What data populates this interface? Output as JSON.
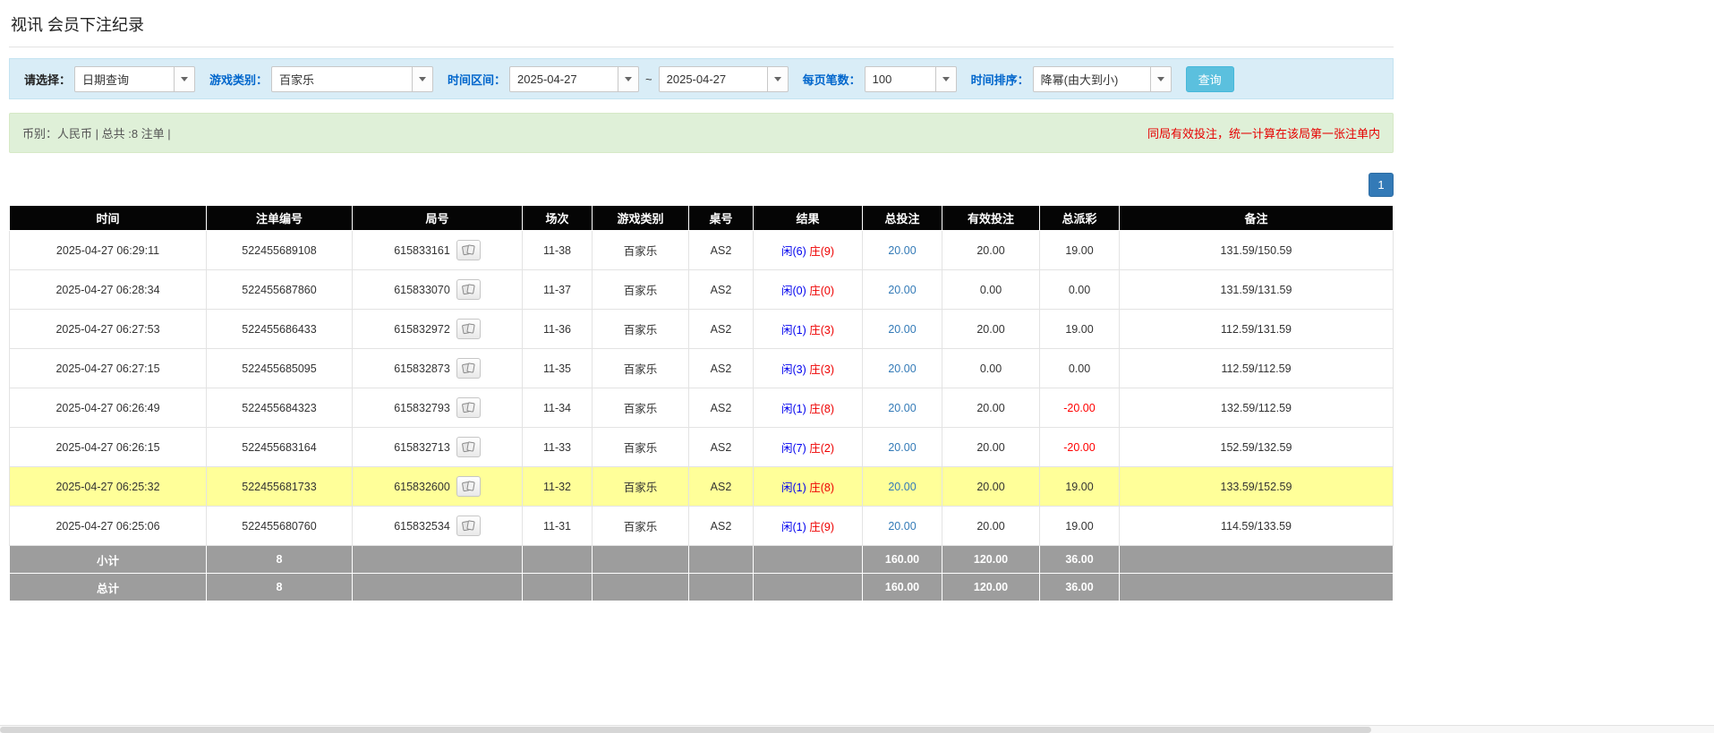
{
  "page": {
    "title": "视讯 会员下注纪录"
  },
  "filters": {
    "select_label": "请选择：",
    "select_value": "日期查询",
    "game_type_label": "游戏类别：",
    "game_type_value": "百家乐",
    "time_range_label": "时间区间：",
    "date_from": "2025-04-27",
    "range_separator": "~",
    "date_to": "2025-04-27",
    "page_size_label": "每页笔数：",
    "page_size_value": "100",
    "sort_label": "时间排序：",
    "sort_value": "降幂(由大到小)",
    "search_button_label": "查询"
  },
  "summary": {
    "left_text": "币别：人民币 | 总共 :8 注单 |",
    "right_note": "同局有效投注，统一计算在该局第一张注单内"
  },
  "pagination": {
    "current_page": "1"
  },
  "table": {
    "headers": [
      "时间",
      "注单编号",
      "局号",
      "场次",
      "游戏类别",
      "桌号",
      "结果",
      "总投注",
      "有效投注",
      "总派彩",
      "备注"
    ],
    "rows": [
      {
        "time": "2025-04-27 06:29:11",
        "bet_id": "522455689108",
        "round_id": "615833161",
        "session": "11-38",
        "game_type": "百家乐",
        "table_no": "AS2",
        "result_player": "闲(6)",
        "result_banker": "庄(9)",
        "total_bet": "20.00",
        "valid_bet": "20.00",
        "payout": "19.00",
        "remark": "131.59/150.59",
        "highlight": false
      },
      {
        "time": "2025-04-27 06:28:34",
        "bet_id": "522455687860",
        "round_id": "615833070",
        "session": "11-37",
        "game_type": "百家乐",
        "table_no": "AS2",
        "result_player": "闲(0)",
        "result_banker": "庄(0)",
        "total_bet": "20.00",
        "valid_bet": "0.00",
        "payout": "0.00",
        "remark": "131.59/131.59",
        "highlight": false
      },
      {
        "time": "2025-04-27 06:27:53",
        "bet_id": "522455686433",
        "round_id": "615832972",
        "session": "11-36",
        "game_type": "百家乐",
        "table_no": "AS2",
        "result_player": "闲(1)",
        "result_banker": "庄(3)",
        "total_bet": "20.00",
        "valid_bet": "20.00",
        "payout": "19.00",
        "remark": "112.59/131.59",
        "highlight": false
      },
      {
        "time": "2025-04-27 06:27:15",
        "bet_id": "522455685095",
        "round_id": "615832873",
        "session": "11-35",
        "game_type": "百家乐",
        "table_no": "AS2",
        "result_player": "闲(3)",
        "result_banker": "庄(3)",
        "total_bet": "20.00",
        "valid_bet": "0.00",
        "payout": "0.00",
        "remark": "112.59/112.59",
        "highlight": false
      },
      {
        "time": "2025-04-27 06:26:49",
        "bet_id": "522455684323",
        "round_id": "615832793",
        "session": "11-34",
        "game_type": "百家乐",
        "table_no": "AS2",
        "result_player": "闲(1)",
        "result_banker": "庄(8)",
        "total_bet": "20.00",
        "valid_bet": "20.00",
        "payout": "-20.00",
        "remark": "132.59/112.59",
        "highlight": false
      },
      {
        "time": "2025-04-27 06:26:15",
        "bet_id": "522455683164",
        "round_id": "615832713",
        "session": "11-33",
        "game_type": "百家乐",
        "table_no": "AS2",
        "result_player": "闲(7)",
        "result_banker": "庄(2)",
        "total_bet": "20.00",
        "valid_bet": "20.00",
        "payout": "-20.00",
        "remark": "152.59/132.59",
        "highlight": false
      },
      {
        "time": "2025-04-27 06:25:32",
        "bet_id": "522455681733",
        "round_id": "615832600",
        "session": "11-32",
        "game_type": "百家乐",
        "table_no": "AS2",
        "result_player": "闲(1)",
        "result_banker": "庄(8)",
        "total_bet": "20.00",
        "valid_bet": "20.00",
        "payout": "19.00",
        "remark": "133.59/152.59",
        "highlight": true
      },
      {
        "time": "2025-04-27 06:25:06",
        "bet_id": "522455680760",
        "round_id": "615832534",
        "session": "11-31",
        "game_type": "百家乐",
        "table_no": "AS2",
        "result_player": "闲(1)",
        "result_banker": "庄(9)",
        "total_bet": "20.00",
        "valid_bet": "20.00",
        "payout": "19.00",
        "remark": "114.59/133.59",
        "highlight": false
      }
    ],
    "subtotal_row": {
      "label": "小计",
      "count": "8",
      "total_bet": "160.00",
      "valid_bet": "120.00",
      "payout": "36.00"
    },
    "total_row": {
      "label": "总计",
      "count": "8",
      "total_bet": "160.00",
      "valid_bet": "120.00",
      "payout": "36.00"
    }
  },
  "colors": {
    "player_blue": "#0000ee",
    "banker_red": "#ee0000",
    "link_blue": "#337ab7",
    "negative_red": "#ff0000",
    "highlight_yellow": "#ffff99",
    "header_black": "#050505",
    "footer_gray": "#9d9d9d",
    "filter_bar_blue": "#d9edf7",
    "summary_bar_green": "#dff0d8"
  }
}
